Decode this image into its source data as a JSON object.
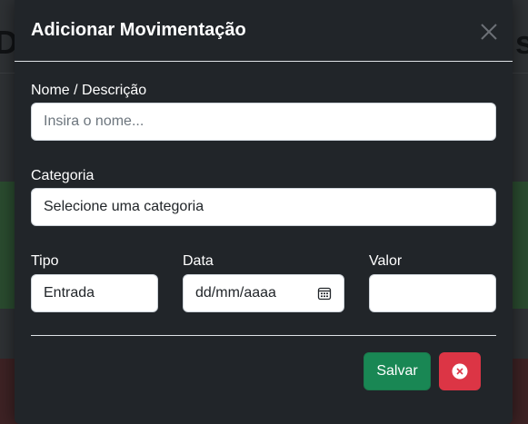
{
  "background": {
    "heading_left": "D",
    "heading_right": "s"
  },
  "modal": {
    "title": "Adicionar Movimentação",
    "close_icon": "close-icon"
  },
  "form": {
    "name": {
      "label": "Nome / Descrição",
      "placeholder": "Insira o nome..."
    },
    "category": {
      "label": "Categoria",
      "value": "Selecione uma categoria"
    },
    "type": {
      "label": "Tipo",
      "value": "Entrada"
    },
    "date": {
      "label": "Data",
      "placeholder": "dd/mm/aaaa",
      "icon": "calendar-icon"
    },
    "amount": {
      "label": "Valor",
      "value": ""
    }
  },
  "footer": {
    "save_label": "Salvar",
    "cancel_icon": "x-circle-icon"
  },
  "colors": {
    "modal_bg": "#212529",
    "save": "#198754",
    "cancel": "#dc3545"
  }
}
